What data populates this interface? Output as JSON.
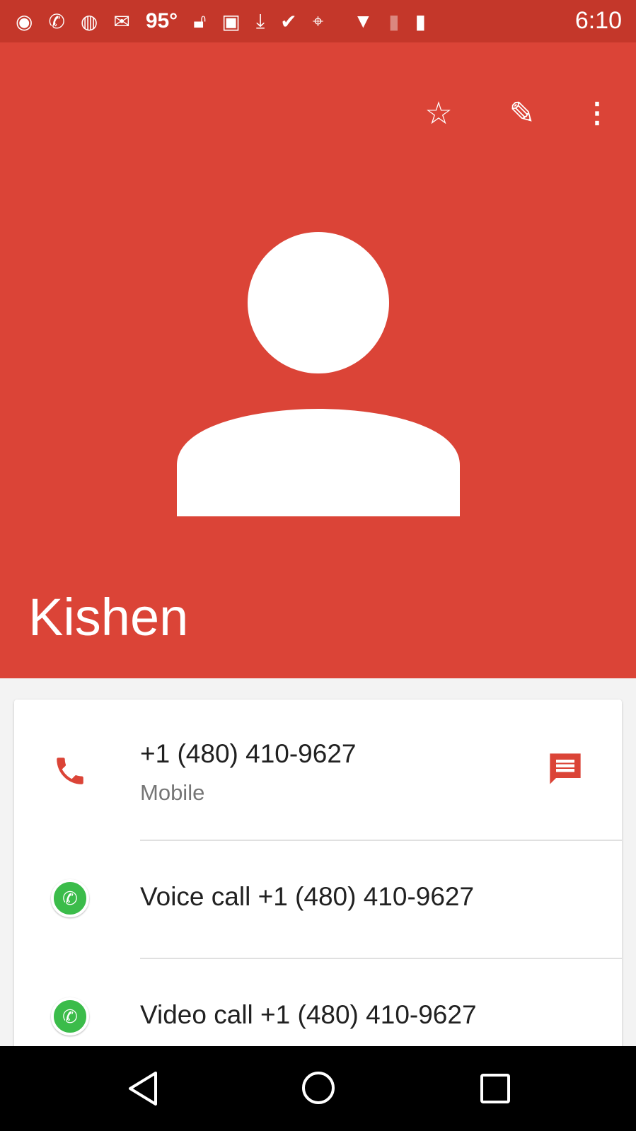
{
  "status_bar": {
    "temperature": "95°",
    "time": "6:10",
    "icons": [
      "spotify-icon",
      "whatsapp-icon",
      "pa-icon",
      "gmail-icon",
      "lock-open-icon",
      "image-icon",
      "download-icon",
      "check-icon",
      "maps-icon",
      "wifi-icon",
      "no-sim-icon",
      "battery-icon"
    ]
  },
  "header": {
    "contact_name": "Kishen",
    "color": "#db4437"
  },
  "contact": {
    "phone": {
      "number": "+1 (480) 410-9627",
      "type": "Mobile"
    },
    "whatsapp_voice": "Voice call +1 (480) 410-9627",
    "whatsapp_video": "Video call +1 (480) 410-9627"
  }
}
